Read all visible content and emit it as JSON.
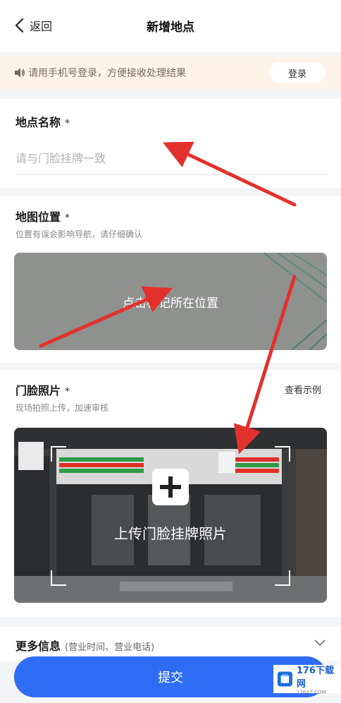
{
  "header": {
    "back_label": "返回",
    "title": "新增地点"
  },
  "notice": {
    "icon": "speaker-icon",
    "text": "请用手机号登录，方便接收处理结果",
    "login_label": "登录"
  },
  "name_section": {
    "label": "地点名称",
    "required_mark": "*",
    "placeholder": "请与门脸挂牌一致"
  },
  "map_section": {
    "label": "地图位置",
    "required_mark": "*",
    "hint": "位置有误会影响导航，请仔细确认",
    "action_text": "点击标记所在位置"
  },
  "photo_section": {
    "label": "门脸照片",
    "required_mark": "*",
    "hint": "现场拍照上传，加速审核",
    "example_link": "查看示例",
    "upload_text": "上传门脸挂牌照片"
  },
  "more_section": {
    "label": "更多信息",
    "hint": "(营业时间、营业电话)"
  },
  "submit_label": "提交",
  "watermark": {
    "line1": "176下载网",
    "line2": "176XZ.COM"
  },
  "colors": {
    "primary": "#2f6cf6",
    "notice_bg": "#fff3e8",
    "annotation": "#e2312d"
  }
}
